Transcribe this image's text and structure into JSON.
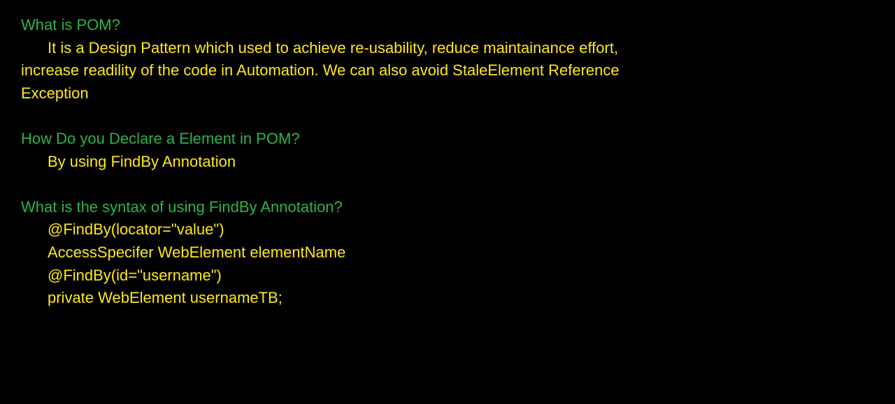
{
  "colors": {
    "background": "#000000",
    "question": "#2db34a",
    "answer": "#ffe81a"
  },
  "qa": [
    {
      "question": "What is POM?",
      "answer": "It is a Design Pattern which used to achieve re-usability, reduce maintainance effort, increase readility of the code in Automation. We can also avoid StaleElement Reference Exception"
    },
    {
      "question": "How Do you Declare a Element in POM?",
      "answer": "By using FindBy Annotation"
    },
    {
      "question": "What is the syntax of using FindBy Annotation?",
      "code": [
        "@FindBy(locator=\"value\")",
        "AccessSpecifer WebElement elementName",
        "@FindBy(id=\"username\")",
        "private WebElement usernameTB;"
      ]
    }
  ]
}
